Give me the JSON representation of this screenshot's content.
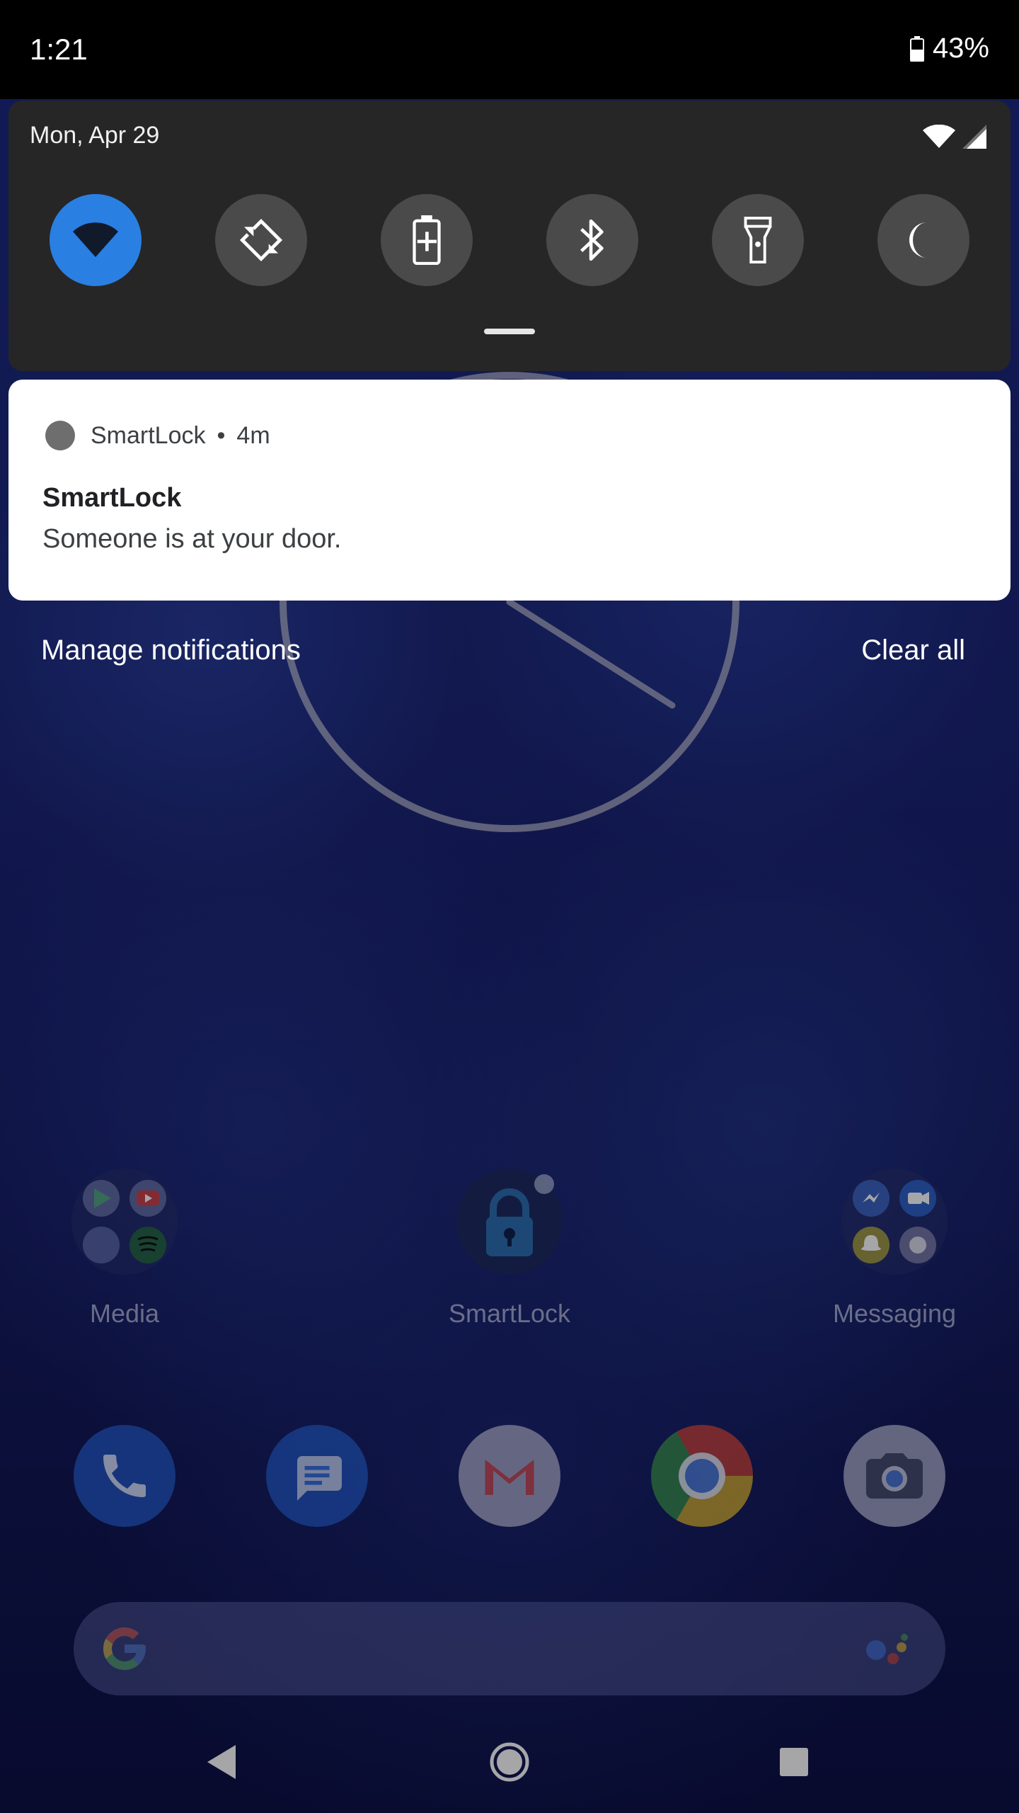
{
  "status_bar": {
    "time": "1:21",
    "battery_percent": "43%",
    "icons": [
      "battery-icon"
    ]
  },
  "quick_settings": {
    "date": "Mon, Apr 29",
    "status_icons": [
      "wifi-icon",
      "cell-signal-icon"
    ],
    "tiles": [
      {
        "name": "wifi-tile",
        "icon": "wifi-icon",
        "active": true
      },
      {
        "name": "auto-rotate-tile",
        "icon": "auto-rotate-icon",
        "active": false
      },
      {
        "name": "battery-saver-tile",
        "icon": "battery-saver-icon",
        "active": false
      },
      {
        "name": "bluetooth-tile",
        "icon": "bluetooth-icon",
        "active": false
      },
      {
        "name": "flashlight-tile",
        "icon": "flashlight-icon",
        "active": false
      },
      {
        "name": "night-mode-tile",
        "icon": "moon-icon",
        "active": false
      }
    ],
    "active_color": "#2a7fe3"
  },
  "notification": {
    "app_name": "SmartLock",
    "separator": "•",
    "time_ago": "4m",
    "title": "SmartLock",
    "text": "Someone is at your door."
  },
  "notification_actions": {
    "manage": "Manage notifications",
    "clear": "Clear all"
  },
  "home_screen": {
    "apps": [
      {
        "label": "Media",
        "icon": "media-folder-icon"
      },
      {
        "label": "SmartLock",
        "icon": "smartlock-app-icon"
      },
      {
        "label": "Messaging",
        "icon": "messaging-folder-icon"
      }
    ],
    "dock": [
      "phone-icon",
      "messages-icon",
      "gmail-icon",
      "chrome-icon",
      "camera-icon"
    ]
  },
  "search_bar": {
    "icons": [
      "google-g-icon",
      "assistant-icon"
    ]
  },
  "nav_bar": {
    "buttons": [
      "back-icon",
      "home-icon",
      "recents-icon"
    ]
  }
}
